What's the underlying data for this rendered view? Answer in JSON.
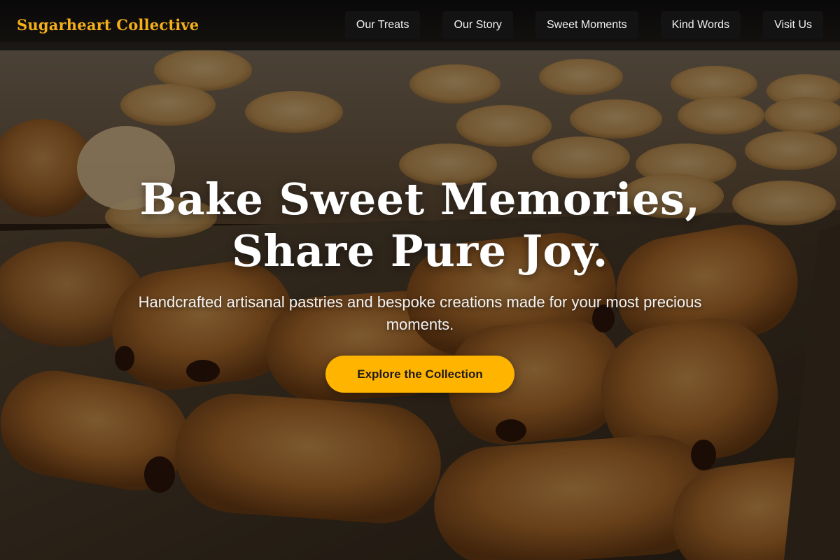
{
  "header": {
    "brand": "Sugarheart Collective",
    "nav": [
      {
        "label": "Our Treats"
      },
      {
        "label": "Our Story"
      },
      {
        "label": "Sweet Moments"
      },
      {
        "label": "Kind Words"
      },
      {
        "label": "Visit Us"
      }
    ]
  },
  "hero": {
    "title_line1": "Bake Sweet Memories,",
    "title_line2": "Share Pure Joy.",
    "subtitle": "Handcrafted artisanal pastries and bespoke creations made for your most precious moments.",
    "cta_label": "Explore the Collection",
    "background_description": "trays of pain au chocolat and golden pastries"
  },
  "colors": {
    "brand": "#f5b019",
    "cta": "#ffb400",
    "header_bg": "#0d0d0d",
    "nav_button_bg": "#141414",
    "hero_text": "#ffffff"
  }
}
